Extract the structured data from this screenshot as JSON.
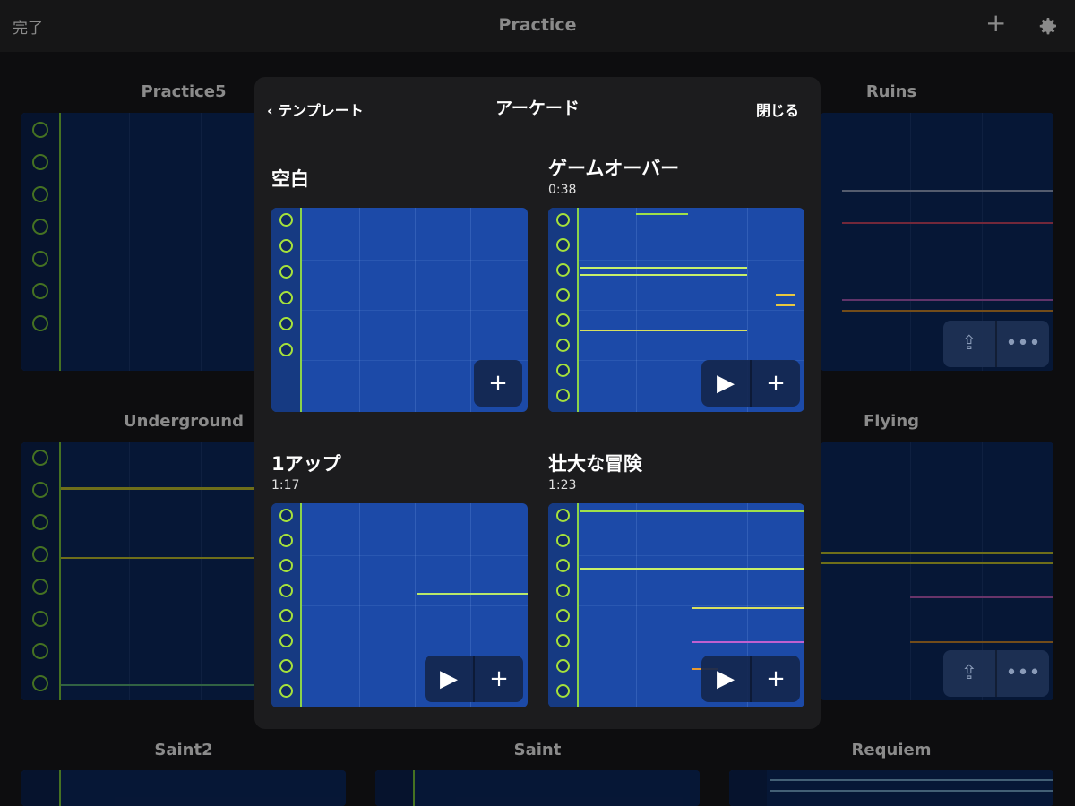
{
  "topbar": {
    "done_label": "完了",
    "title": "Practice",
    "add_icon": "plus-icon",
    "settings_icon": "gear-icon"
  },
  "background": {
    "songs": [
      "Practice5",
      "Ruins",
      "Underground",
      "Flying",
      "Saint2",
      "Saint",
      "Requiem"
    ]
  },
  "modal": {
    "back_label": "テンプレート",
    "title": "アーケード",
    "close_label": "閉じる",
    "templates": [
      {
        "name": "空白",
        "duration": ""
      },
      {
        "name": "ゲームオーバー",
        "duration": "0:38"
      },
      {
        "name": "1アップ",
        "duration": "1:17"
      },
      {
        "name": "壮大な冒険",
        "duration": "1:23"
      }
    ],
    "play_glyph": "▶",
    "add_glyph": "+"
  },
  "colors": {
    "accent_green": "#8bd34a",
    "card_blue": "#1c4aa8",
    "modal_bg": "#1c1c1e",
    "page_bg": "#0d0d0f"
  }
}
